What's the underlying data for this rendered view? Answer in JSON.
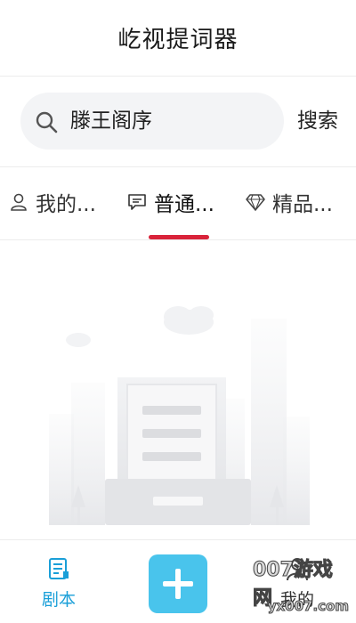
{
  "header": {
    "title": "屹视提词器"
  },
  "search": {
    "value": "滕王阁序",
    "button_label": "搜索"
  },
  "tabs": [
    {
      "label": "我的...",
      "icon": "user-icon"
    },
    {
      "label": "普通...",
      "icon": "message-icon",
      "active": true
    },
    {
      "label": "精品...",
      "icon": "diamond-icon"
    }
  ],
  "bottom_nav": {
    "script_label": "剧本",
    "script_icon": "script-icon",
    "add_icon": "plus-icon",
    "profile_label": "我的",
    "profile_icon": "profile-icon"
  },
  "watermark": {
    "line1": "007游戏网",
    "line2": "yx007.com"
  },
  "colors": {
    "accent_red": "#d9233a",
    "accent_blue": "#1a9fd8",
    "add_button": "#49c4ec"
  }
}
